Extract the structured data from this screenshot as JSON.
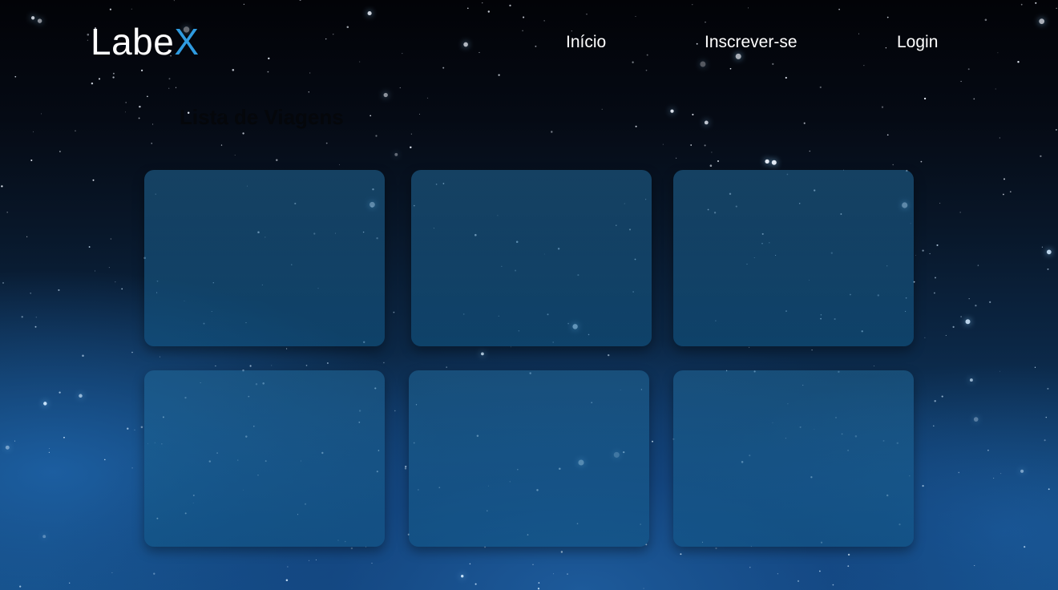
{
  "brand": {
    "logo_main": "Labe",
    "logo_accent": "X"
  },
  "nav": {
    "home": "Início",
    "signup": "Inscrever-se",
    "login": "Login"
  },
  "main": {
    "title": "Lista de Viagens",
    "trip_cards": [
      "",
      "",
      "",
      "",
      "",
      ""
    ]
  },
  "colors": {
    "accent": "#2f9be0",
    "card": "#145f91"
  }
}
